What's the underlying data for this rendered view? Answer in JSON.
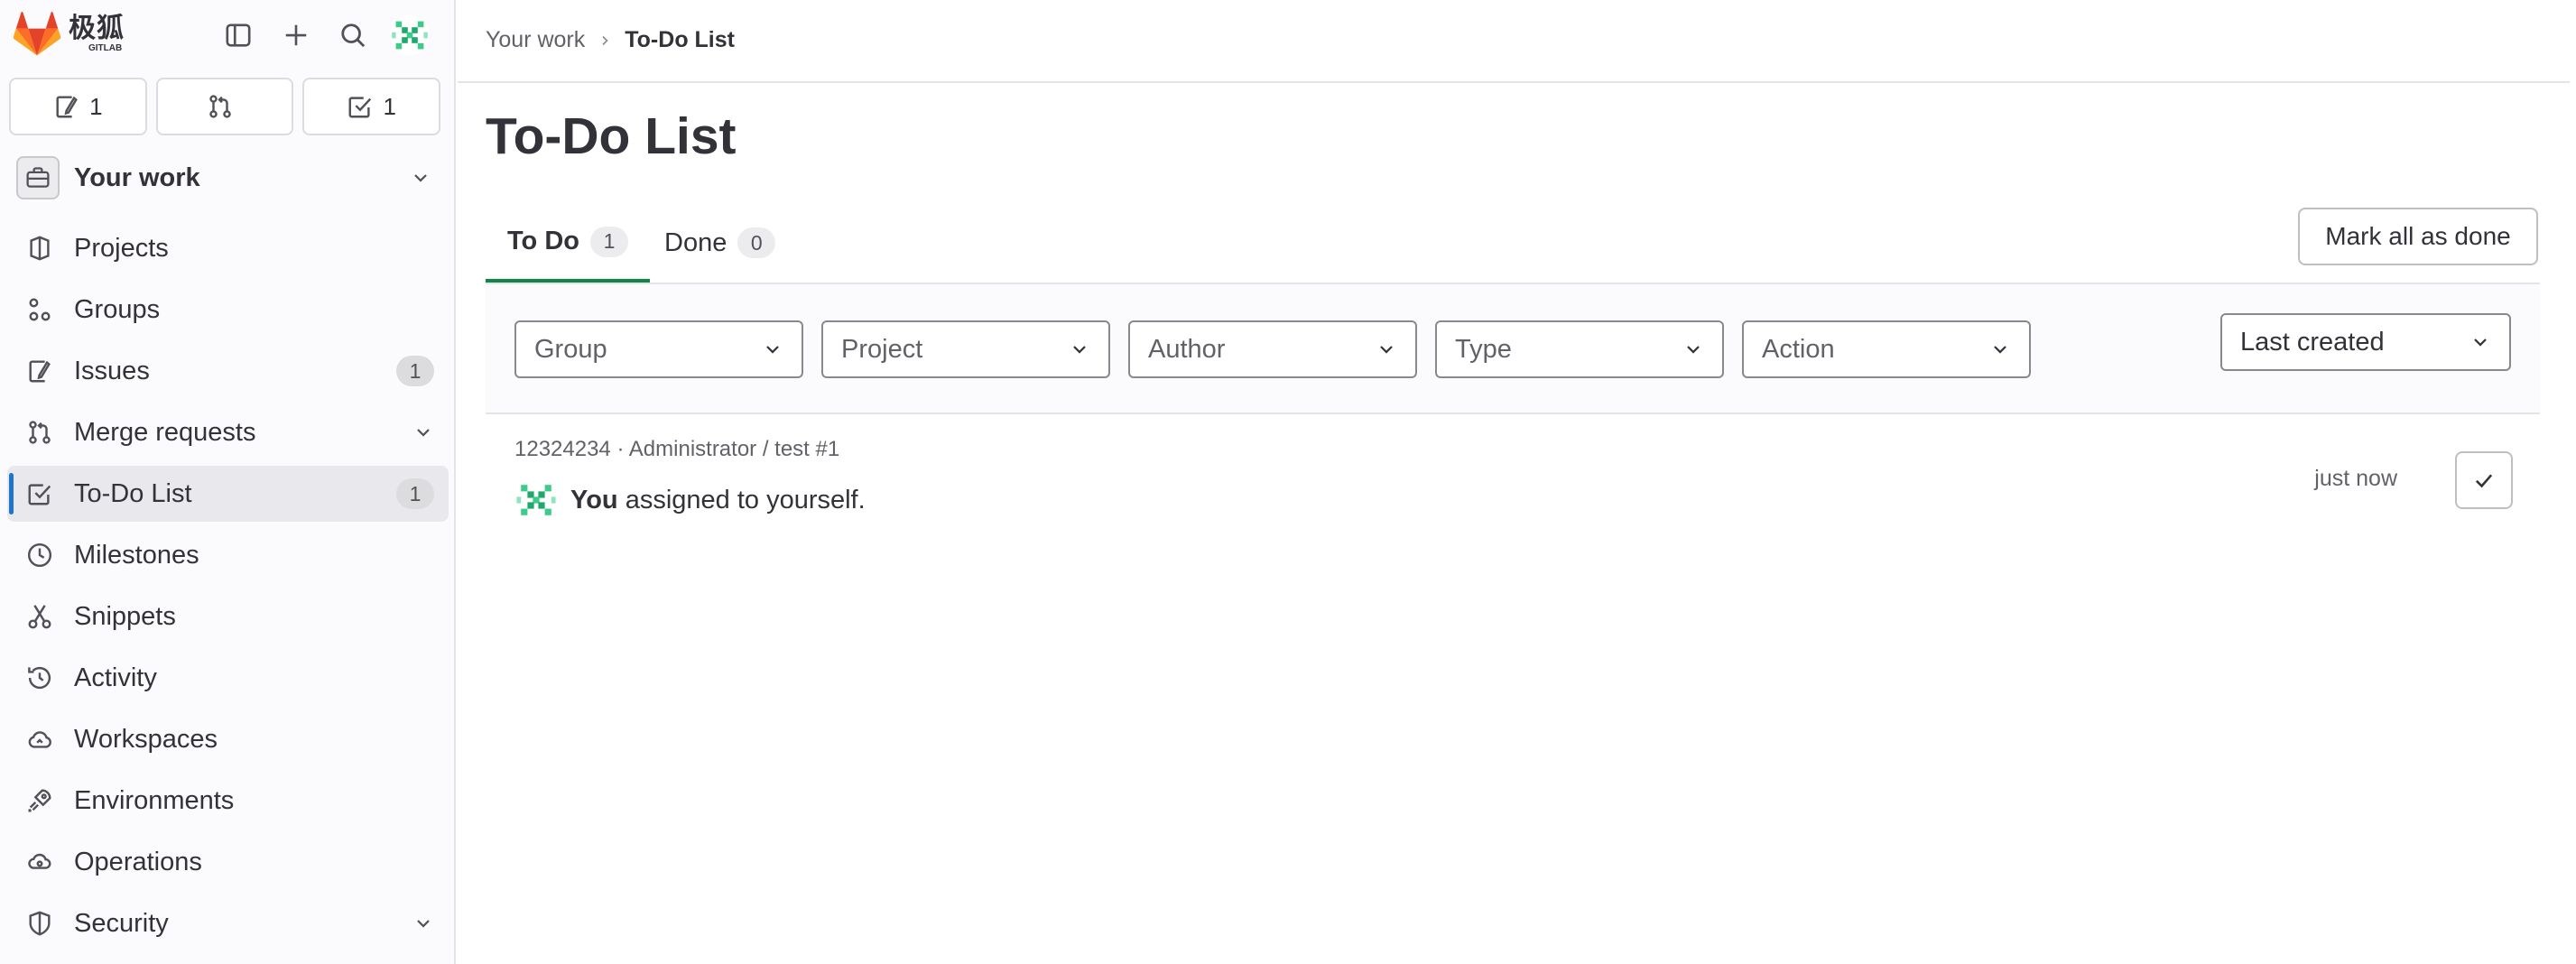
{
  "brand": {
    "name_cn": "极狐",
    "name_en": "GITLAB"
  },
  "counts": {
    "issues": "1",
    "merge_requests": "",
    "todos": "1"
  },
  "context": {
    "label": "Your work"
  },
  "nav": [
    {
      "label": "Projects",
      "icon": "project-icon"
    },
    {
      "label": "Groups",
      "icon": "group-icon"
    },
    {
      "label": "Issues",
      "icon": "issues-icon",
      "badge": "1"
    },
    {
      "label": "Merge requests",
      "icon": "merge-request-icon",
      "expandable": true
    },
    {
      "label": "To-Do List",
      "icon": "todo-icon",
      "badge": "1",
      "active": true
    },
    {
      "label": "Milestones",
      "icon": "milestone-icon"
    },
    {
      "label": "Snippets",
      "icon": "snippet-icon"
    },
    {
      "label": "Activity",
      "icon": "history-icon"
    },
    {
      "label": "Workspaces",
      "icon": "cloud-icon"
    },
    {
      "label": "Environments",
      "icon": "environment-icon"
    },
    {
      "label": "Operations",
      "icon": "operations-icon"
    },
    {
      "label": "Security",
      "icon": "shield-icon",
      "expandable": true
    }
  ],
  "breadcrumb": {
    "parent": "Your work",
    "current": "To-Do List"
  },
  "page": {
    "title": "To-Do List"
  },
  "tabs": [
    {
      "label": "To Do",
      "count": "1",
      "active": true
    },
    {
      "label": "Done",
      "count": "0",
      "active": false
    }
  ],
  "actions": {
    "mark_all": "Mark all as done"
  },
  "filters": [
    "Group",
    "Project",
    "Author",
    "Type",
    "Action"
  ],
  "sort": {
    "selected": "Last created"
  },
  "todo": {
    "meta": "12324234 · Administrator / test #1",
    "actor": "You",
    "text": "assigned to yourself.",
    "time": "just now"
  },
  "colors": {
    "accent": "#1f75cb",
    "tab_active": "#108548",
    "brand": "#e24329"
  }
}
